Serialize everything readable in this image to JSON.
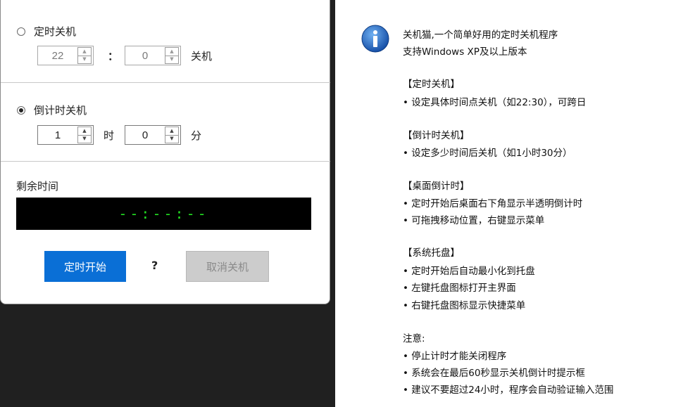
{
  "dialog": {
    "timed_shutdown": {
      "label": "定时关机",
      "hour": "22",
      "colon": "：",
      "minute": "0",
      "suffix": "关机"
    },
    "countdown_shutdown": {
      "label": "倒计时关机",
      "hours": "1",
      "hours_unit": "时",
      "minutes": "0",
      "minutes_unit": "分"
    },
    "remaining": {
      "label": "剩余时间",
      "display": "--:--:--"
    },
    "buttons": {
      "start": "定时开始",
      "help": "?",
      "cancel": "取消关机"
    }
  },
  "info": {
    "intro_line1": "关机猫,一个简单好用的定时关机程序",
    "intro_line2": "支持Windows XP及以上版本",
    "sec1_title": "【定时关机】",
    "sec1_item1": "• 设定具体时间点关机（如22:30），可跨日",
    "sec2_title": "【倒计时关机】",
    "sec2_item1": "• 设定多少时间后关机（如1小时30分）",
    "sec3_title": "【桌面倒计时】",
    "sec3_item1": "• 定时开始后桌面右下角显示半透明倒计时",
    "sec3_item2": "• 可拖拽移动位置，右键显示菜单",
    "sec4_title": "【系统托盘】",
    "sec4_item1": "• 定时开始后自动最小化到托盘",
    "sec4_item2": "• 左键托盘图标打开主界面",
    "sec4_item3": "• 右键托盘图标显示快捷菜单",
    "note_title": "注意:",
    "note_item1": "• 停止计时才能关闭程序",
    "note_item2": "• 系统会在最后60秒显示关机倒计时提示框",
    "note_item3": "• 建议不要超过24小时，程序会自动验证输入范围"
  },
  "colors": {
    "primary_button": "#0a6fd6",
    "timer_digits": "#22dd22",
    "timer_bg": "#000000"
  }
}
